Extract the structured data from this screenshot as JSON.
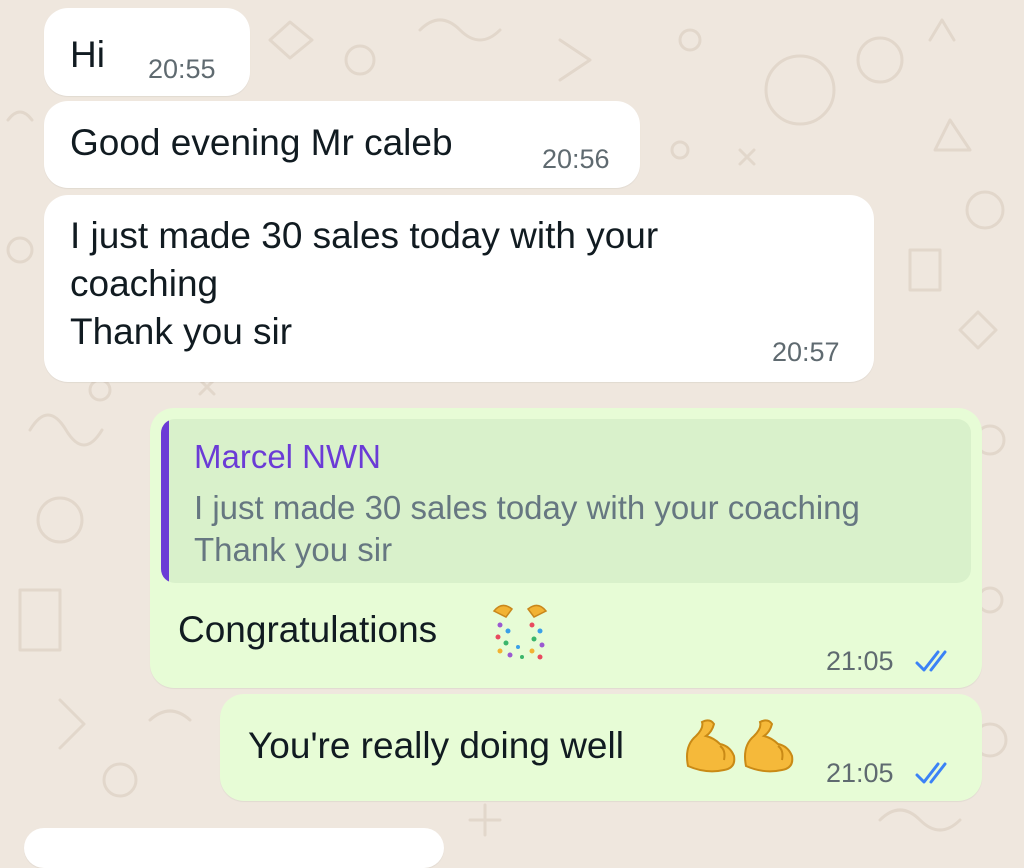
{
  "messages": [
    {
      "id": "m1",
      "direction": "incoming",
      "text": "Hi",
      "time": "20:55"
    },
    {
      "id": "m2",
      "direction": "incoming",
      "text": "Good evening Mr caleb",
      "time": "20:56"
    },
    {
      "id": "m3",
      "direction": "incoming",
      "lines": [
        "I just made 30 sales today with your",
        "coaching",
        "Thank you sir"
      ],
      "time": "20:57"
    },
    {
      "id": "m4",
      "direction": "outgoing",
      "quote": {
        "author": "Marcel NWN",
        "lines": [
          "I just made 30 sales today with your coaching",
          "Thank you sir"
        ]
      },
      "text": "Congratulations",
      "emoji": "party-popper",
      "time": "21:05",
      "status": "read"
    },
    {
      "id": "m5",
      "direction": "outgoing",
      "text": "You're really doing well",
      "emoji": "flexed-biceps",
      "time": "21:05",
      "status": "read"
    }
  ],
  "colors": {
    "background": "#efe7de",
    "incoming_bubble": "#ffffff",
    "outgoing_bubble": "#e7fcd6",
    "quote_background": "#d9f1cb",
    "quote_accent": "#6b3bd6",
    "read_ticks": "#3b82f6"
  }
}
